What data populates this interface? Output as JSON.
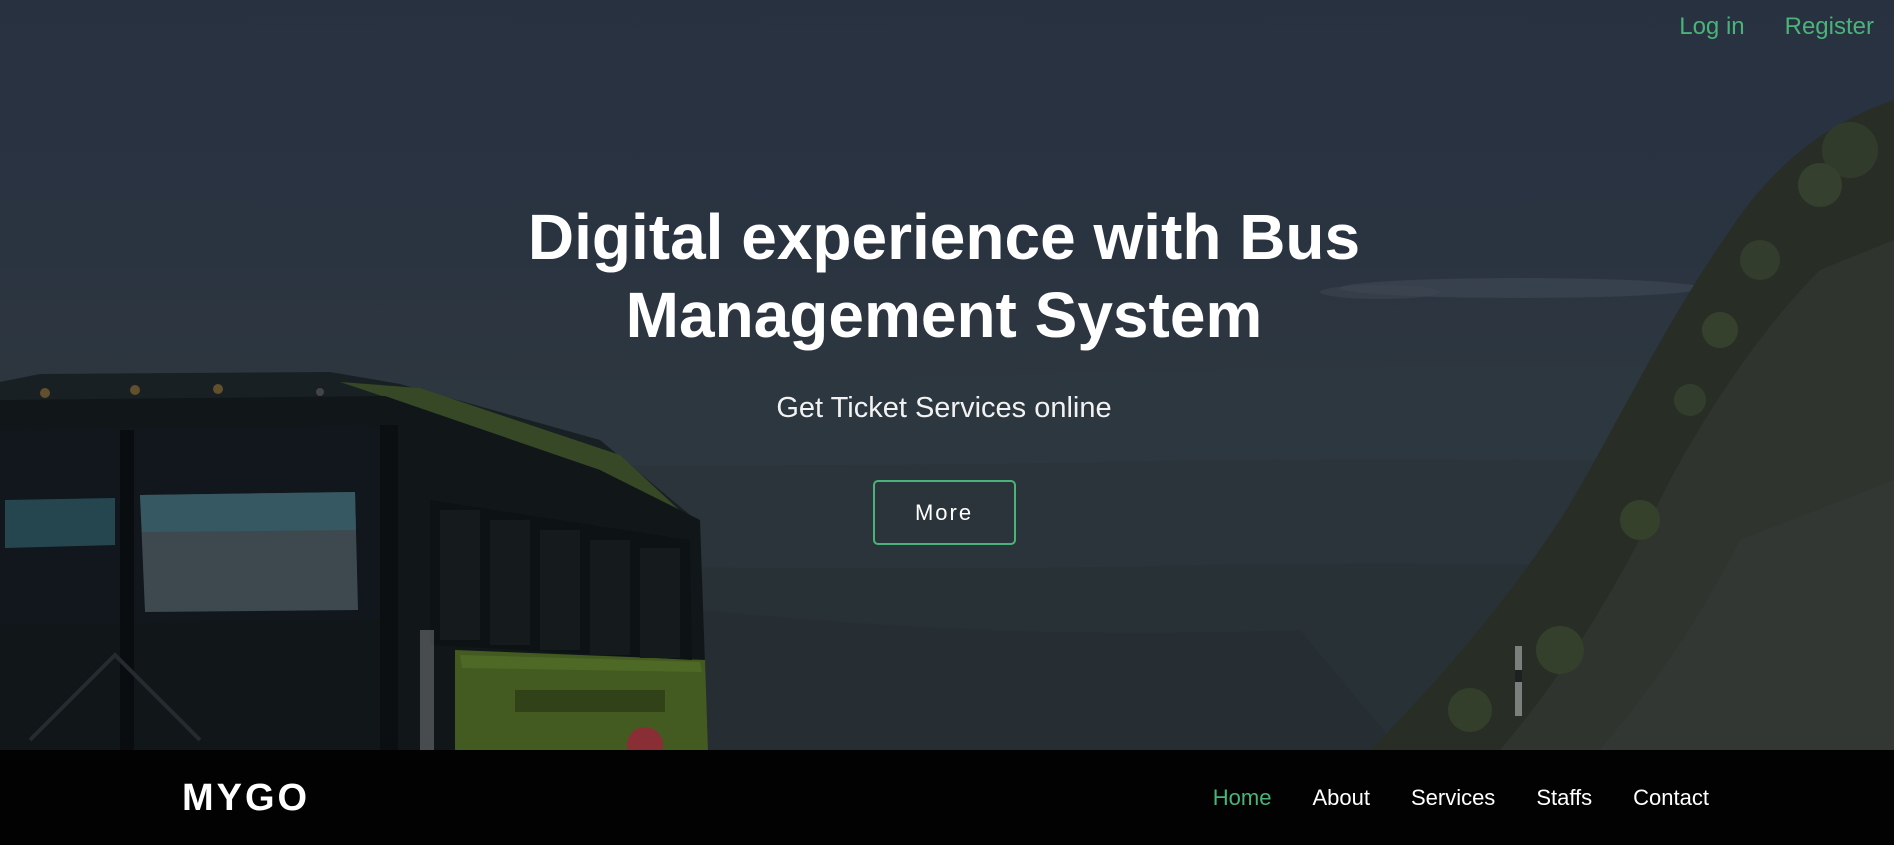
{
  "auth": {
    "login_label": "Log in",
    "register_label": "Register"
  },
  "hero": {
    "title": "Digital experience with Bus Management System",
    "subtitle": "Get Ticket Services online",
    "button_label": "More"
  },
  "navbar": {
    "brand": "MYGO",
    "items": [
      {
        "label": "Home",
        "active": true
      },
      {
        "label": "About",
        "active": false
      },
      {
        "label": "Services",
        "active": false
      },
      {
        "label": "Staffs",
        "active": false
      },
      {
        "label": "Contact",
        "active": false
      }
    ]
  },
  "colors": {
    "accent": "#4ab379",
    "navbar_bg": "#020202",
    "hero_tint": "#2b3646",
    "text": "#ffffff"
  }
}
